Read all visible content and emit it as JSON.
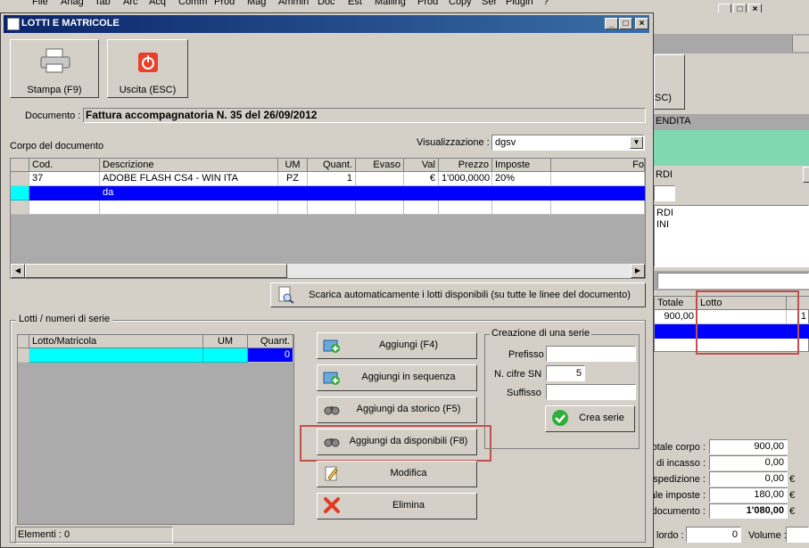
{
  "background_app": {
    "menu_items": [
      "File",
      "Anag",
      "Tab",
      "Arc",
      "Acq",
      "Comm",
      "Prod",
      "Mag",
      "Ammin",
      "Doc",
      "Est",
      "Mailing",
      "Prod",
      "Copy",
      "Ser",
      "Plugin",
      "?"
    ],
    "exit_label_fragment": "SC)",
    "sale_label": "ENDITA",
    "rdi_label": "RDI",
    "list_lines": [
      "RDI",
      "INI"
    ],
    "table_headers": {
      "totale": "Totale",
      "lotto": "Lotto"
    },
    "row_value": "900,00",
    "row_extra": "1",
    "totals": [
      {
        "label": "Totale corpo :",
        "value": "900,00",
        "unit": ""
      },
      {
        "label": "e di incasso :",
        "value": "0,00",
        "unit": ""
      },
      {
        "label": "e spedizione :",
        "value": "0,00",
        "unit": "€"
      },
      {
        "label": "tale imposte :",
        "value": "180,00",
        "unit": "€"
      },
      {
        "label": "documento :",
        "value": "1'080,00",
        "unit": "€"
      }
    ],
    "bottom": {
      "lordo_label": "lordo :",
      "lordo_value": "0",
      "volume_label": "Volume :"
    }
  },
  "window": {
    "title": "LOTTI E MATRICOLE"
  },
  "toolbar": {
    "print_label": "Stampa (F9)",
    "exit_label": "Uscita (ESC)"
  },
  "document": {
    "label": "Documento :",
    "value": "Fattura accompagnatoria N. 35 del 26/09/2012"
  },
  "body_section": {
    "label": "Corpo del documento",
    "view_label": "Visualizzazione :",
    "view_value": "dgsv",
    "columns": [
      "Cod.",
      "Descrizione",
      "UM",
      "Quant.",
      "Evaso",
      "Val",
      "Prezzo",
      "Imposte",
      "Fo"
    ],
    "rows": [
      [
        "37",
        "ADOBE FLASH CS4 - WIN ITA",
        "PZ",
        "1",
        "",
        "€",
        "1'000,0000",
        "20%",
        ""
      ],
      [
        "",
        "da",
        "",
        "",
        "",
        "",
        "",
        "",
        ""
      ],
      [
        "",
        "",
        "",
        "",
        "",
        "",
        "",
        "",
        ""
      ]
    ]
  },
  "auto_button": {
    "label": "Scarica automaticamente i lotti disponibili (su tutte le linee del documento)"
  },
  "lots": {
    "group_label": "Lotti / numeri di serie",
    "columns": [
      "Lotto/Matricola",
      "UM",
      "Quant."
    ],
    "rows": [
      [
        "",
        "",
        "0"
      ]
    ],
    "elements_label": "Elementi : 0"
  },
  "actions": {
    "add": "Aggiungi (F4)",
    "add_sequence": "Aggiungi in sequenza",
    "add_history": "Aggiungi da storico (F5)",
    "add_available": "Aggiungi da disponibili (F8)",
    "edit": "Modifica",
    "delete": "Elimina"
  },
  "series": {
    "group_label": "Creazione di una serie",
    "prefix_label": "Prefisso",
    "prefix_value": "",
    "digits_label": "N. cifre SN",
    "digits_value": "5",
    "suffix_label": "Suffisso",
    "suffix_value": "",
    "create_label": "Crea serie"
  },
  "colors": {
    "selection": "#0000ff",
    "lot_row": "#00ffff",
    "highlight": "#c0504d"
  }
}
